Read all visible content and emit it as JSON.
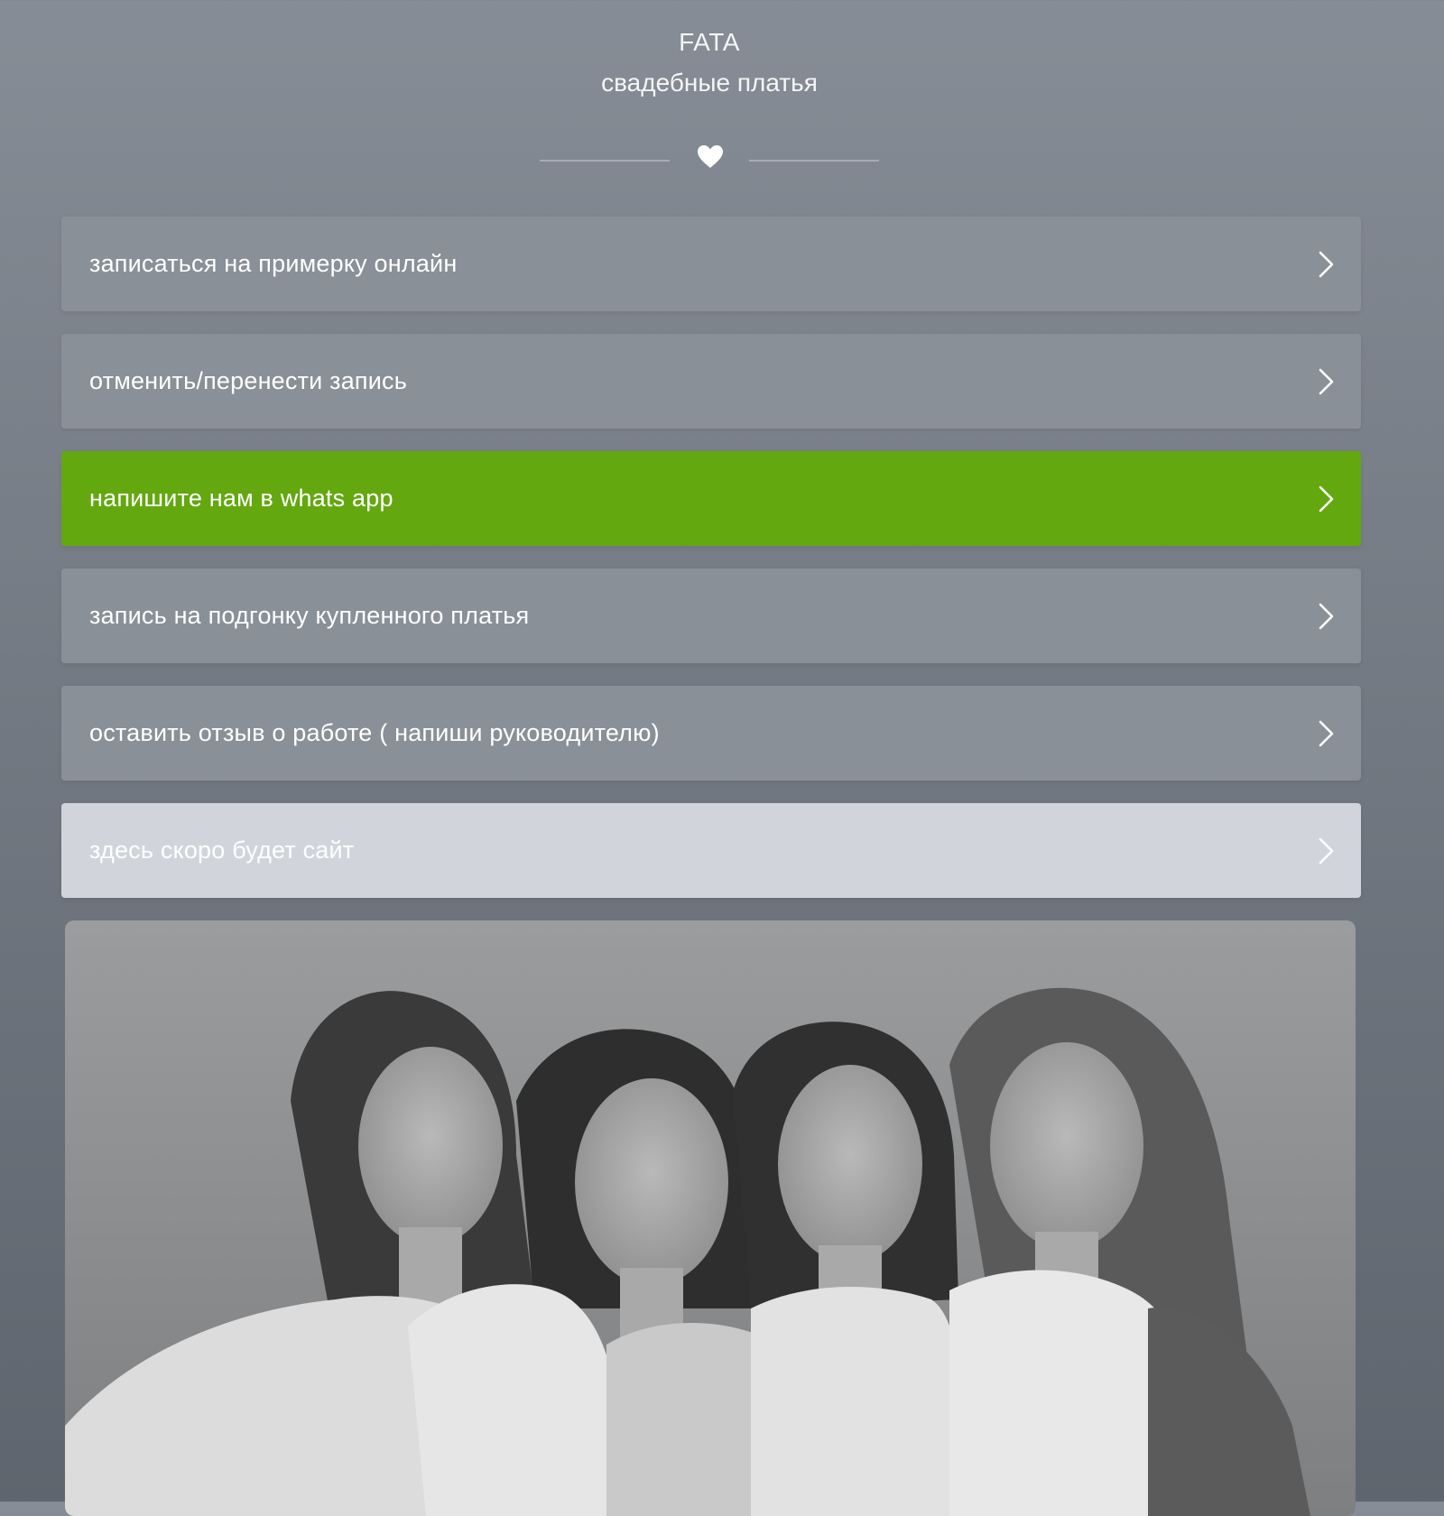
{
  "header": {
    "brand": "FATA",
    "tagline": "свадебные платья"
  },
  "links": [
    {
      "label": "записаться на примерку онлайн",
      "style": "default"
    },
    {
      "label": "отменить/перенести запись",
      "style": "default"
    },
    {
      "label": "напишите нам в whats app",
      "style": "green"
    },
    {
      "label": "запись на подгонку купленного платья",
      "style": "default"
    },
    {
      "label": "оставить отзыв о работе ( напиши руководителю)",
      "style": "default"
    },
    {
      "label": "здесь скоро будет сайт",
      "style": "light"
    }
  ],
  "icons": {
    "divider": "heart-icon",
    "link_arrow": "chevron-right-icon"
  },
  "colors": {
    "green_button": "#63a80f",
    "default_button": "#8a9097",
    "light_button": "#d1d5db"
  }
}
